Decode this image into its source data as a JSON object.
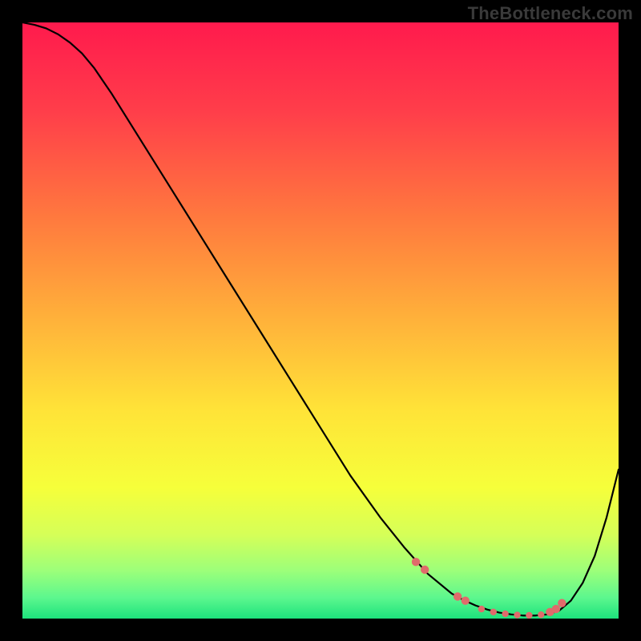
{
  "watermark": "TheBottleneck.com",
  "chart_data": {
    "type": "line",
    "title": "",
    "xlabel": "",
    "ylabel": "",
    "xlim": [
      0,
      100
    ],
    "ylim": [
      0,
      100
    ],
    "grid": false,
    "legend": false,
    "gradient_stops": [
      {
        "offset": 0.0,
        "color": "#ff1a4d"
      },
      {
        "offset": 0.15,
        "color": "#ff3e4a"
      },
      {
        "offset": 0.33,
        "color": "#ff7a3e"
      },
      {
        "offset": 0.5,
        "color": "#ffb23a"
      },
      {
        "offset": 0.65,
        "color": "#ffe338"
      },
      {
        "offset": 0.78,
        "color": "#f6ff3a"
      },
      {
        "offset": 0.86,
        "color": "#d5ff58"
      },
      {
        "offset": 0.92,
        "color": "#9cff7a"
      },
      {
        "offset": 0.965,
        "color": "#5cf78e"
      },
      {
        "offset": 1.0,
        "color": "#1de27c"
      }
    ],
    "series": [
      {
        "name": "curve",
        "stroke": "#000000",
        "stroke_width": 2.2,
        "x": [
          0,
          2,
          4,
          6,
          8,
          10,
          12,
          15,
          20,
          25,
          30,
          35,
          40,
          45,
          50,
          55,
          60,
          64,
          68,
          72,
          74,
          76,
          78,
          80,
          82,
          84,
          86,
          88,
          90,
          92,
          94,
          96,
          98,
          100
        ],
        "y": [
          100,
          99.6,
          99.0,
          98.0,
          96.6,
          94.8,
          92.4,
          88,
          80,
          72,
          64,
          56,
          48,
          40,
          32,
          24,
          17,
          12,
          7.5,
          4.2,
          3.1,
          2.2,
          1.5,
          1.0,
          0.7,
          0.5,
          0.5,
          0.7,
          1.3,
          3.0,
          6.0,
          10.5,
          17.0,
          25.0
        ]
      }
    ],
    "markers": {
      "color": "#e06b6b",
      "radius_small": 4.2,
      "radius_large": 5.2,
      "positions_x": [
        66,
        67.5,
        73,
        74.3,
        77,
        79,
        81,
        83,
        85,
        87,
        88.5,
        89.5,
        90.5
      ],
      "positions_y": [
        9.5,
        8.2,
        3.7,
        3.0,
        1.6,
        1.1,
        0.8,
        0.6,
        0.55,
        0.65,
        1.1,
        1.6,
        2.6
      ],
      "large_indices": [
        0,
        1,
        2,
        3,
        10,
        11,
        12
      ]
    }
  }
}
